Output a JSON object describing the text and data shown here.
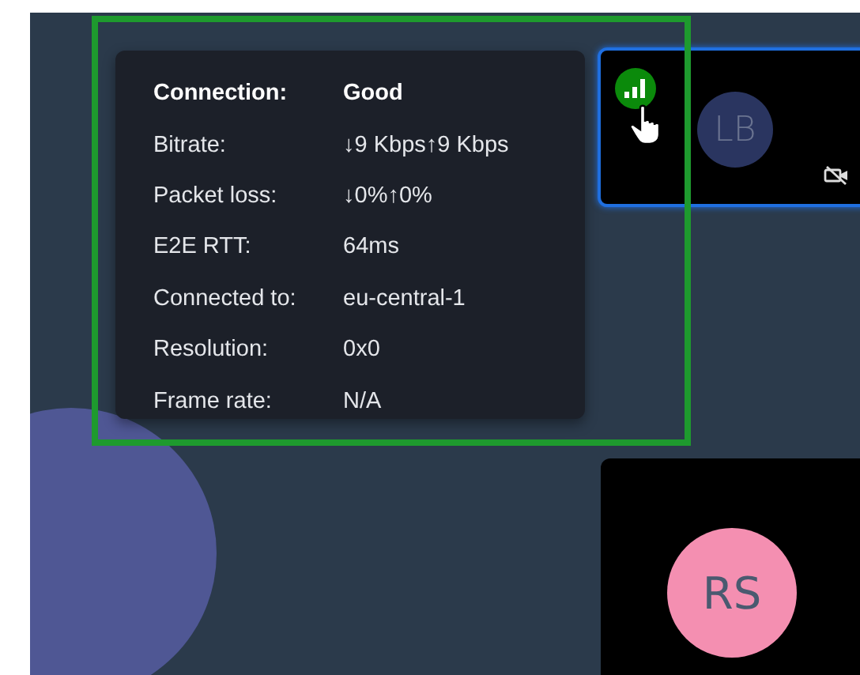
{
  "speaker": {
    "color": "#4f5794"
  },
  "stats": [
    {
      "label": "Connection:",
      "value": "Good",
      "bold": true
    },
    {
      "label": "Bitrate:",
      "value": "↓9 Kbps↑9 Kbps",
      "bold": false
    },
    {
      "label": "Packet loss:",
      "value": "↓0%↑0%",
      "bold": false
    },
    {
      "label": "E2E RTT:",
      "value": "64ms",
      "bold": false
    },
    {
      "label": "Connected to:",
      "value": "eu-central-1",
      "bold": false
    },
    {
      "label": "Resolution:",
      "value": "0x0",
      "bold": false
    },
    {
      "label": "Frame rate:",
      "value": "N/A",
      "bold": false
    }
  ],
  "tiles": [
    {
      "initials": "LB",
      "color": "#2a3560",
      "selected": true,
      "camera_off": true,
      "signal_icon": true
    },
    {
      "initials": "RS",
      "color": "#f48fb1",
      "selected": false,
      "camera_off": false,
      "signal_icon": false
    }
  ]
}
